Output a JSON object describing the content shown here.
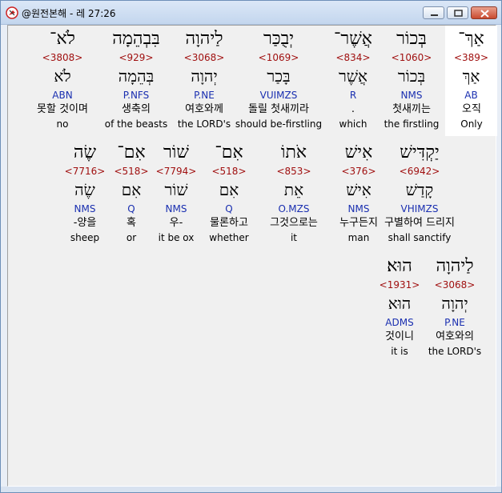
{
  "window": {
    "title": "@원전본해 - 레 27:26",
    "icon": "bible-app-icon",
    "buttons": [
      "minimize-icon",
      "maximize-icon",
      "close-icon"
    ]
  },
  "rows": [
    [
      {
        "heb": "אַךְ־",
        "strong": "<389>",
        "lex": "אַךְ",
        "morph": "AB",
        "kor": "오직",
        "eng": "Only",
        "highlight": true
      },
      {
        "heb": "בְּכוֹר",
        "strong": "<1060>",
        "lex": "בְּכוֹר",
        "morph": "NMS",
        "kor": "첫새끼는",
        "eng": "the firstling"
      },
      {
        "heb": "אֲשֶׁר־",
        "strong": "<834>",
        "lex": "אֲשֶׁר",
        "morph": "R",
        "kor": ".",
        "eng": "which"
      },
      {
        "heb": "יְבֻכַּר",
        "strong": "<1069>",
        "lex": "בָּכַר",
        "morph": "VUIMZS",
        "kor": "돌릴 첫새끼라",
        "eng": "should be-firstling"
      },
      {
        "heb": "לַיהוָה",
        "strong": "<3068>",
        "lex": "יְהוָה",
        "morph": "P.NE",
        "kor": "여호와께",
        "eng": "the LORD's"
      },
      {
        "heb": "בִּבְהֵמָה",
        "strong": "<929>",
        "lex": "בְּהֵמָה",
        "morph": "P.NFS",
        "kor": "생축의",
        "eng": "of the beasts"
      },
      {
        "heb": "לֹא־",
        "strong": "<3808>",
        "lex": "לֹא",
        "morph": "ABN",
        "kor": "못할 것이며",
        "eng": "no"
      }
    ],
    [
      {
        "heb": "יַקְדִּישׁ",
        "strong": "<6942>",
        "lex": "קָדַשׁ",
        "morph": "VHIMZS",
        "kor": "구별하여 드리지",
        "eng": "shall sanctify"
      },
      {
        "heb": "אִישׁ",
        "strong": "<376>",
        "lex": "אִישׁ",
        "morph": "NMS",
        "kor": "누구든지",
        "eng": "man"
      },
      {
        "heb": "אֹתוֹ",
        "strong": "<853>",
        "lex": "אֵת",
        "morph": "O.MZS",
        "kor": "그것으로는",
        "eng": "it"
      },
      {
        "heb": "אִם־",
        "strong": "<518>",
        "lex": "אִם",
        "morph": "Q",
        "kor": "물론하고",
        "eng": "whether"
      },
      {
        "heb": "שׁוֹר",
        "strong": "<7794>",
        "lex": "שׁוֹר",
        "morph": "NMS",
        "kor": "우-",
        "eng": "it be ox"
      },
      {
        "heb": "אִם־",
        "strong": "<518>",
        "lex": "אִם",
        "morph": "Q",
        "kor": "혹",
        "eng": "or"
      },
      {
        "heb": "שֶׂה",
        "strong": "<7716>",
        "lex": "שֶׂה",
        "morph": "NMS",
        "kor": "-양을",
        "eng": "sheep"
      }
    ],
    [
      {
        "heb": "לַיהוָה",
        "strong": "<3068>",
        "lex": "יְהוָה",
        "morph": "P.NE",
        "kor": "여호와의",
        "eng": "the LORD's"
      },
      {
        "heb": "הוּא׃",
        "strong": "<1931>",
        "lex": "הוּא",
        "morph": "ADMS",
        "kor": "것이니",
        "eng": "it is"
      }
    ]
  ]
}
